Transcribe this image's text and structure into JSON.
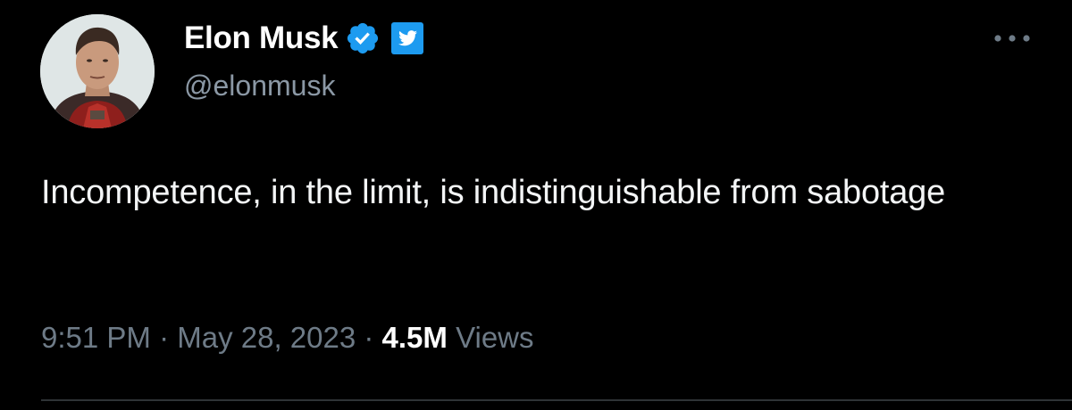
{
  "author": {
    "display_name": "Elon Musk",
    "handle": "@elonmusk",
    "avatar_icon": "profile-photo",
    "verified_icon": "blue-verified-checkmark-icon",
    "affiliation_icon": "twitter-bird-badge-icon"
  },
  "menu": {
    "more_icon": "more-options-ellipsis-icon"
  },
  "tweet": {
    "text": "Incompetence, in the limit, is indistinguishable from sabotage",
    "time": "9:51 PM",
    "separator": " · ",
    "date": "May 28, 2023",
    "views_count": "4.5M",
    "views_label": "Views"
  },
  "colors": {
    "background": "#000000",
    "name": "#ffffff",
    "handle": "#8b98a5",
    "body_text": "#f3f5f6",
    "meta": "#6e7b87",
    "verified": "#1d9bf0",
    "divider": "#2f3336"
  }
}
